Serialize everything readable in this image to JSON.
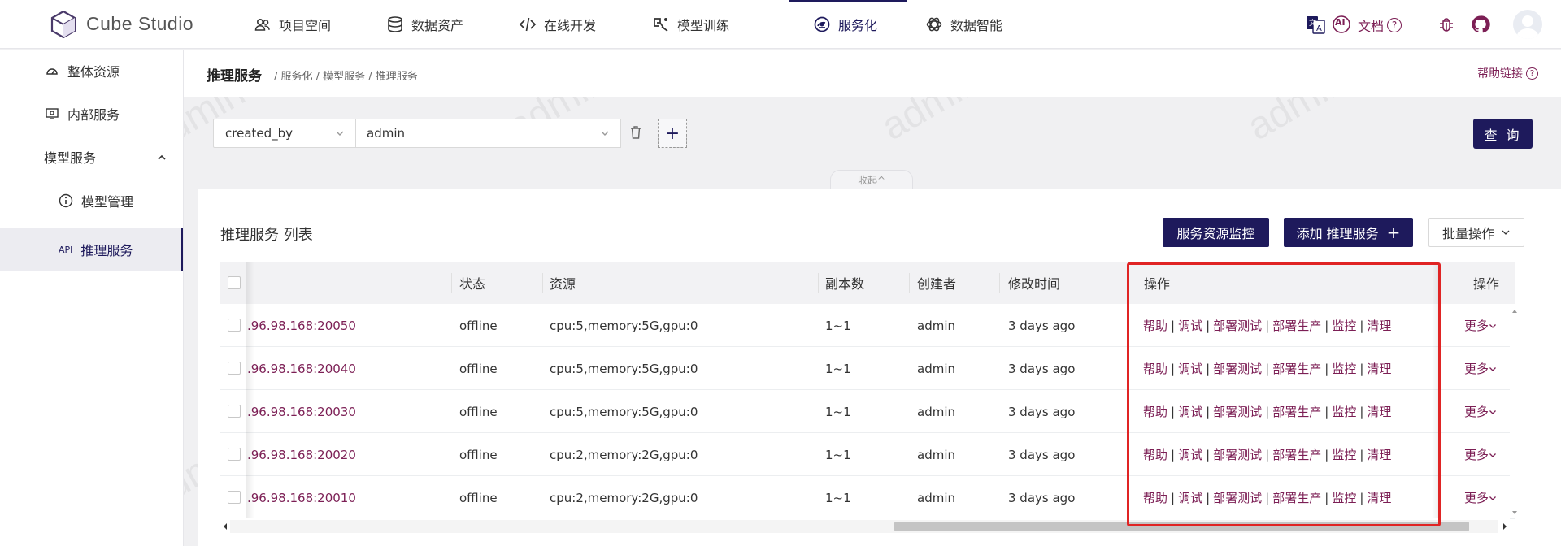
{
  "app": {
    "brand": "Cube Studio"
  },
  "nav": [
    {
      "label": "项目空间",
      "icon": "users-icon"
    },
    {
      "label": "数据资产",
      "icon": "database-icon"
    },
    {
      "label": "在线开发",
      "icon": "code-icon"
    },
    {
      "label": "模型训练",
      "icon": "training-icon"
    },
    {
      "label": "服务化",
      "icon": "service-icon",
      "active": true
    },
    {
      "label": "数据智能",
      "icon": "openai-icon"
    }
  ],
  "topright": {
    "docs_label": "文档",
    "ai_label": "AI"
  },
  "sidebar": {
    "items": [
      {
        "label": "整体资源",
        "icon": "dashboard-icon"
      },
      {
        "label": "内部服务",
        "icon": "monitor-icon"
      },
      {
        "label": "模型服务",
        "icon": "chevron-up-icon",
        "group": true
      },
      {
        "label": "模型管理",
        "icon": "info-icon",
        "sub": true
      },
      {
        "label": "推理服务",
        "icon_text": "API",
        "sub": true,
        "active": true
      }
    ]
  },
  "header": {
    "title": "推理服务",
    "breadcrumb": "/ 服务化 / 模型服务 / 推理服务",
    "help_link": "帮助链接"
  },
  "filter": {
    "field": "created_by",
    "value": "admin",
    "query_button": "查 询",
    "collapse_label": "收起^"
  },
  "list": {
    "title": "推理服务 列表",
    "monitor_button": "服务资源监控",
    "add_button": "添加 推理服务",
    "batch_button": "批量操作"
  },
  "table": {
    "columns": [
      "状态",
      "资源",
      "副本数",
      "创建者",
      "修改时间",
      "操作",
      "操作"
    ],
    "rows": [
      {
        "host": ".96.98.168:20050",
        "status": "offline",
        "resource": "cpu:5,memory:5G,gpu:0",
        "replicas": "1~1",
        "creator": "admin",
        "modified": "3 days ago"
      },
      {
        "host": ".96.98.168:20040",
        "status": "offline",
        "resource": "cpu:5,memory:5G,gpu:0",
        "replicas": "1~1",
        "creator": "admin",
        "modified": "3 days ago"
      },
      {
        "host": ".96.98.168:20030",
        "status": "offline",
        "resource": "cpu:5,memory:5G,gpu:0",
        "replicas": "1~1",
        "creator": "admin",
        "modified": "3 days ago"
      },
      {
        "host": ".96.98.168:20020",
        "status": "offline",
        "resource": "cpu:2,memory:2G,gpu:0",
        "replicas": "1~1",
        "creator": "admin",
        "modified": "3 days ago"
      },
      {
        "host": ".96.98.168:20010",
        "status": "offline",
        "resource": "cpu:2,memory:2G,gpu:0",
        "replicas": "1~1",
        "creator": "admin",
        "modified": "3 days ago"
      }
    ],
    "actions": [
      "帮助",
      "调试",
      "部署测试",
      "部署生产",
      "监控",
      "清理"
    ],
    "more_label": "更多"
  },
  "watermark_text": "admin",
  "colors": {
    "primary": "#1e1a5c",
    "link": "#7c1f55",
    "highlight": "#e02424"
  }
}
